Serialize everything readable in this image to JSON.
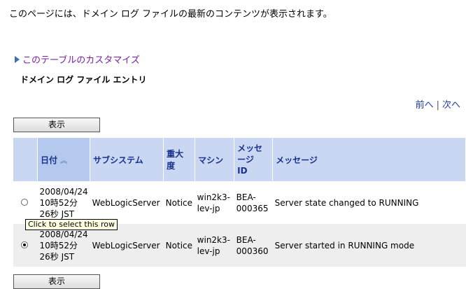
{
  "intro_text": "このページには、ドメイン ログ ファイルの最新のコンテンツが表示されます。",
  "customize_link": "このテーブルのカスタマイズ",
  "section_title": "ドメイン ログ ファイル エントリ",
  "pager": {
    "prev": "前へ",
    "separator": "|",
    "next": "次へ"
  },
  "view_button": "表示",
  "columns": {
    "date": "日付",
    "subsystem": "サブシステム",
    "severity_l1": "重大",
    "severity_l2": "度",
    "machine": "マシン",
    "msgid_l1": "メッセ",
    "msgid_l2": "ージ",
    "msgid_l3": "ID",
    "message": "メッセージ"
  },
  "rows": [
    {
      "selected": false,
      "date_l1": "2008/04/24",
      "date_l2": "10時52分",
      "date_l3": "26秒 JST",
      "subsystem": "WebLogicServer",
      "severity": "Notice",
      "machine_l1": "win2k3-",
      "machine_l2": "lev-jp",
      "msgid_l1": "BEA-",
      "msgid_l2": "000365",
      "message": "Server state changed to RUNNING"
    },
    {
      "selected": true,
      "date_l1": "2008/04/24",
      "date_l2": "10時52分",
      "date_l3": "26秒 JST",
      "subsystem": "WebLogicServer",
      "severity": "Notice",
      "machine_l1": "win2k3-",
      "machine_l2": "lev-jp",
      "msgid_l1": "BEA-",
      "msgid_l2": "000360",
      "message": "Server started in RUNNING mode"
    }
  ],
  "tooltip": "Click to select this row",
  "colors": {
    "header_bg": "#c9d7f2",
    "header_text": "#17308c",
    "link": "#1f3ba6",
    "customize_link": "#7a1fa2"
  },
  "icons": {
    "customize": "triangle-right-icon",
    "sort": "sort-ascending-icon"
  }
}
